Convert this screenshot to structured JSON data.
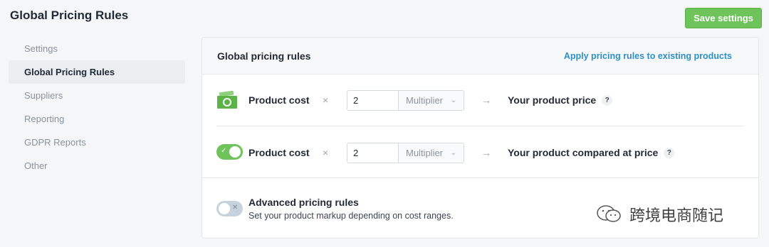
{
  "page": {
    "title": "Global Pricing Rules"
  },
  "toolbar": {
    "save_label": "Save settings"
  },
  "sidebar": {
    "items": [
      {
        "label": "Settings",
        "active": false
      },
      {
        "label": "Global Pricing Rules",
        "active": true
      },
      {
        "label": "Suppliers",
        "active": false
      },
      {
        "label": "Reporting",
        "active": false
      },
      {
        "label": "GDPR Reports",
        "active": false
      },
      {
        "label": "Other",
        "active": false
      }
    ]
  },
  "card": {
    "title": "Global pricing rules",
    "link": "Apply pricing rules to existing products",
    "rules": [
      {
        "icon": "money-icon",
        "label": "Product cost",
        "operator": "×",
        "value": "2",
        "mode": "Multiplier",
        "arrow": "→",
        "result": "Your product price",
        "help": "?"
      },
      {
        "toggle_on": true,
        "label": "Product cost",
        "operator": "×",
        "value": "2",
        "mode": "Multiplier",
        "arrow": "→",
        "result": "Your product compared at price",
        "help": "?"
      }
    ],
    "advanced": {
      "toggle_on": false,
      "title": "Advanced pricing rules",
      "description": "Set your product markup depending on cost ranges."
    }
  },
  "watermark": {
    "text": "跨境电商随记"
  },
  "colors": {
    "accent_green": "#6ec35a",
    "link_blue": "#2d8fc8",
    "toggle_off": "#c7d3dc"
  }
}
